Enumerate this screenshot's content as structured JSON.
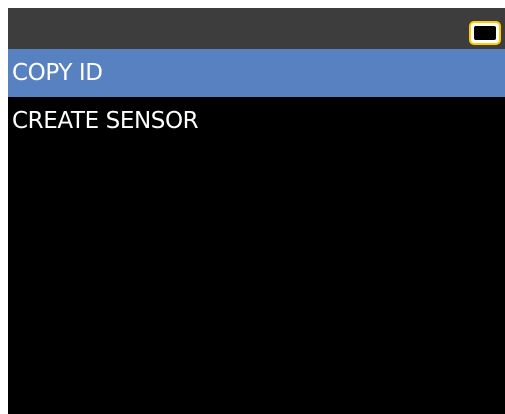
{
  "status_bar": {
    "battery_icon": "battery-icon",
    "background_color": "#3d3d3d",
    "battery_color": "#ffcc00"
  },
  "menu": {
    "items": [
      {
        "label": "COPY ID",
        "selected": true
      },
      {
        "label": "CREATE SENSOR",
        "selected": false
      }
    ],
    "selected_color": "#5781c1"
  }
}
